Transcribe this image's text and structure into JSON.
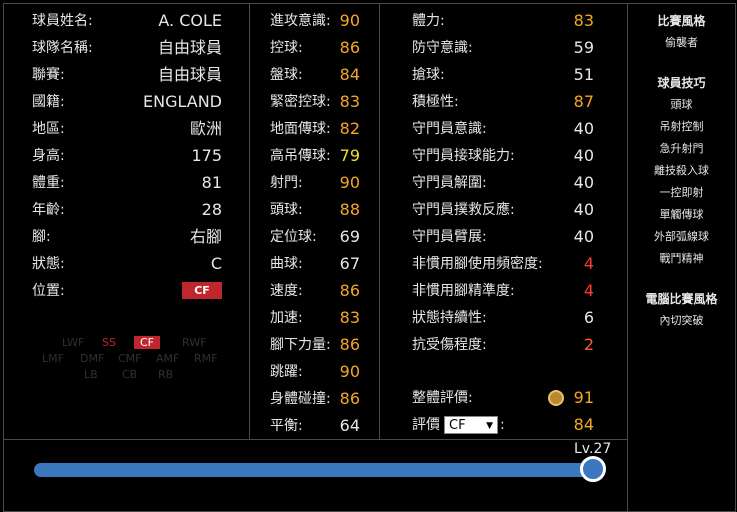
{
  "profile": {
    "name_label": "球員姓名:",
    "name": "A. COLE",
    "team_label": "球隊名稱:",
    "team": "自由球員",
    "league_label": "聯賽:",
    "league": "自由球員",
    "nation_label": "國籍:",
    "nation": "ENGLAND",
    "region_label": "地區:",
    "region": "歐洲",
    "height_label": "身高:",
    "height": "175",
    "weight_label": "體重:",
    "weight": "81",
    "age_label": "年齡:",
    "age": "28",
    "foot_label": "腳:",
    "foot": "右腳",
    "form_label": "狀態:",
    "form": "C",
    "position_label": "位置:",
    "position": "CF"
  },
  "position_map": {
    "row1": [
      "LWF",
      "SS",
      "CF",
      "RWF"
    ],
    "row2": [
      "LMF",
      "DMF",
      "CMF",
      "AMF",
      "RMF"
    ],
    "row3": [
      "LB",
      "CB",
      "RB"
    ]
  },
  "stats_mid": [
    {
      "label": "進攻意識:",
      "value": "90",
      "color": "#f5a623"
    },
    {
      "label": "控球:",
      "value": "86",
      "color": "#f5a623"
    },
    {
      "label": "盤球:",
      "value": "84",
      "color": "#f5a623"
    },
    {
      "label": "緊密控球:",
      "value": "83",
      "color": "#f5a623"
    },
    {
      "label": "地面傳球:",
      "value": "82",
      "color": "#f5a623"
    },
    {
      "label": "高吊傳球:",
      "value": "79",
      "color": "#f0e030"
    },
    {
      "label": "射門:",
      "value": "90",
      "color": "#f5a623"
    },
    {
      "label": "頭球:",
      "value": "88",
      "color": "#f5a623"
    },
    {
      "label": "定位球:",
      "value": "69",
      "color": "#e6e6e6"
    },
    {
      "label": "曲球:",
      "value": "67",
      "color": "#e6e6e6"
    },
    {
      "label": "速度:",
      "value": "86",
      "color": "#f5a623"
    },
    {
      "label": "加速:",
      "value": "83",
      "color": "#f5a623"
    },
    {
      "label": "腳下力量:",
      "value": "86",
      "color": "#f5a623"
    },
    {
      "label": "跳躍:",
      "value": "90",
      "color": "#f5a623"
    },
    {
      "label": "身體碰撞:",
      "value": "86",
      "color": "#f5a623"
    },
    {
      "label": "平衡:",
      "value": "64",
      "color": "#e6e6e6"
    }
  ],
  "stats_right": [
    {
      "label": "體力:",
      "value": "83",
      "color": "#f5a623"
    },
    {
      "label": "防守意識:",
      "value": "59",
      "color": "#e6e6e6"
    },
    {
      "label": "搶球:",
      "value": "51",
      "color": "#e6e6e6"
    },
    {
      "label": "積極性:",
      "value": "87",
      "color": "#f5a623"
    },
    {
      "label": "守門員意識:",
      "value": "40",
      "color": "#e6e6e6"
    },
    {
      "label": "守門員接球能力:",
      "value": "40",
      "color": "#e6e6e6"
    },
    {
      "label": "守門員解圍:",
      "value": "40",
      "color": "#e6e6e6"
    },
    {
      "label": "守門員撲救反應:",
      "value": "40",
      "color": "#e6e6e6"
    },
    {
      "label": "守門員臂展:",
      "value": "40",
      "color": "#e6e6e6"
    },
    {
      "label": "非慣用腳使用頻密度:",
      "value": "4",
      "color": "#ff3a2a"
    },
    {
      "label": "非慣用腳精準度:",
      "value": "4",
      "color": "#ff3a2a"
    },
    {
      "label": "狀態持續性:",
      "value": "6",
      "color": "#e6e6e6"
    },
    {
      "label": "抗受傷程度:",
      "value": "2",
      "color": "#ff5a22"
    }
  ],
  "overall": {
    "label": "整體評價:",
    "value": "91",
    "color": "#f5a623"
  },
  "rating": {
    "label": "評價",
    "select": "CF",
    "value": "84",
    "color": "#f5a623"
  },
  "side": {
    "style_head": "比賽風格",
    "style": "偷襲者",
    "skills_head": "球員技巧",
    "skills": [
      "頭球",
      "吊射控制",
      "急升射門",
      "離技殺入球",
      "一控即射",
      "單觸傳球",
      "外部弧線球",
      "戰鬥精神"
    ],
    "ai_head": "電腦比賽風格",
    "ai": "內切突破"
  },
  "slider": {
    "level_text": "Lv.27",
    "fraction": 1.0
  }
}
